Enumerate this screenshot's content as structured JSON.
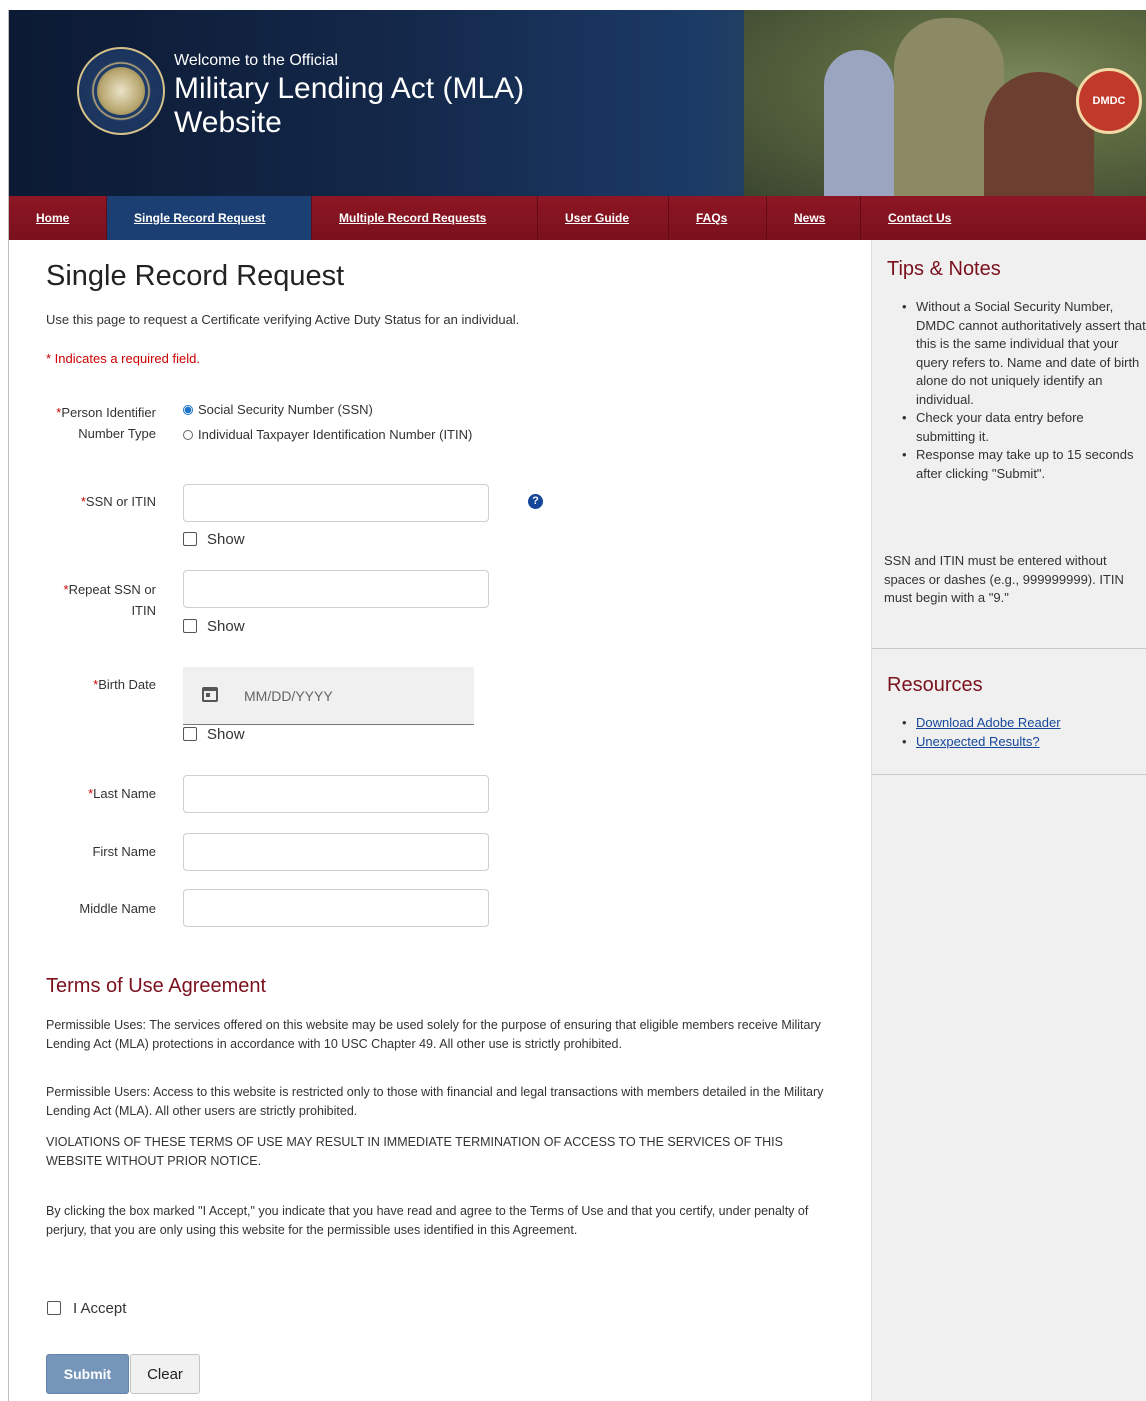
{
  "header": {
    "welcome": "Welcome to the Official",
    "title": "Military Lending Act (MLA) Website",
    "seal_text": "DEPARTMENT OF DEFENSE · UNITED STATES OF AMERICA",
    "dmdc_badge": "DMDC"
  },
  "nav": {
    "items": [
      {
        "label": "Home"
      },
      {
        "label": "Single Record Request"
      },
      {
        "label": "Multiple Record Requests"
      },
      {
        "label": "User Guide"
      },
      {
        "label": "FAQs"
      },
      {
        "label": "News"
      },
      {
        "label": "Contact Us"
      }
    ],
    "active_index": 1
  },
  "main": {
    "title": "Single Record Request",
    "intro": "Use this page to request a Certificate verifying Active Duty Status for an individual.",
    "required_note": "* Indicates a required field.",
    "id_type": {
      "label": "Person Identifier Number Type",
      "options": [
        {
          "label": "Social Security Number (SSN)",
          "selected": true
        },
        {
          "label": "Individual Taxpayer Identification Number (ITIN)",
          "selected": false
        }
      ]
    },
    "ssn": {
      "label": "SSN or ITIN",
      "value": "",
      "show_label": "Show"
    },
    "repeat_ssn": {
      "label": "Repeat SSN or ITIN",
      "value": "",
      "show_label": "Show"
    },
    "birth_date": {
      "label": "Birth Date",
      "placeholder": "MM/DD/YYYY",
      "show_label": "Show"
    },
    "last_name": {
      "label": "Last Name",
      "value": ""
    },
    "first_name": {
      "label": "First Name",
      "value": ""
    },
    "middle_name": {
      "label": "Middle Name",
      "value": ""
    },
    "help_icon": "?"
  },
  "terms": {
    "title": "Terms of Use Agreement",
    "p1": "Permissible Uses: The services offered on this website may be used solely for the purpose of ensuring that eligible members receive Military Lending Act (MLA) protections in accordance with 10 USC Chapter 49. All other use is strictly prohibited.",
    "p2": "Permissible Users: Access to this website is restricted only to those with financial and legal transactions with members detailed in the Military Lending Act (MLA). All other users are strictly prohibited.",
    "p3": "VIOLATIONS OF THESE TERMS OF USE MAY RESULT IN IMMEDIATE TERMINATION OF ACCESS TO THE SERVICES OF THIS WEBSITE WITHOUT PRIOR NOTICE.",
    "p4": "By clicking the box marked \"I Accept,\" you indicate that you have read and agree to the Terms of Use and that you certify, under penalty of perjury, that you are only using this website for the permissible uses identified in this Agreement.",
    "accept_label": "I Accept",
    "submit_label": "Submit",
    "clear_label": "Clear"
  },
  "sidebar": {
    "tips_title": "Tips & Notes",
    "tips": [
      "Without a Social Security Number, DMDC cannot authoritatively assert that this is the same individual that your query refers to. Name and date of birth alone do not uniquely identify an individual.",
      "Check your data entry before submitting it.",
      "Response may take up to 15 seconds after clicking \"Submit\"."
    ],
    "note": "SSN and ITIN must be entered without spaces or dashes (e.g., 999999999). ITIN must begin with a \"9.\"",
    "resources_title": "Resources",
    "resources": [
      {
        "label": "Download Adobe Reader"
      },
      {
        "label": "Unexpected Results?"
      }
    ]
  },
  "colors": {
    "nav_bg": "#7a111d",
    "nav_active": "#1c3f73",
    "accent_red": "#cc0000",
    "heading_red": "#7a111d",
    "link_blue": "#14479a",
    "submit_bg": "#7596b9"
  }
}
